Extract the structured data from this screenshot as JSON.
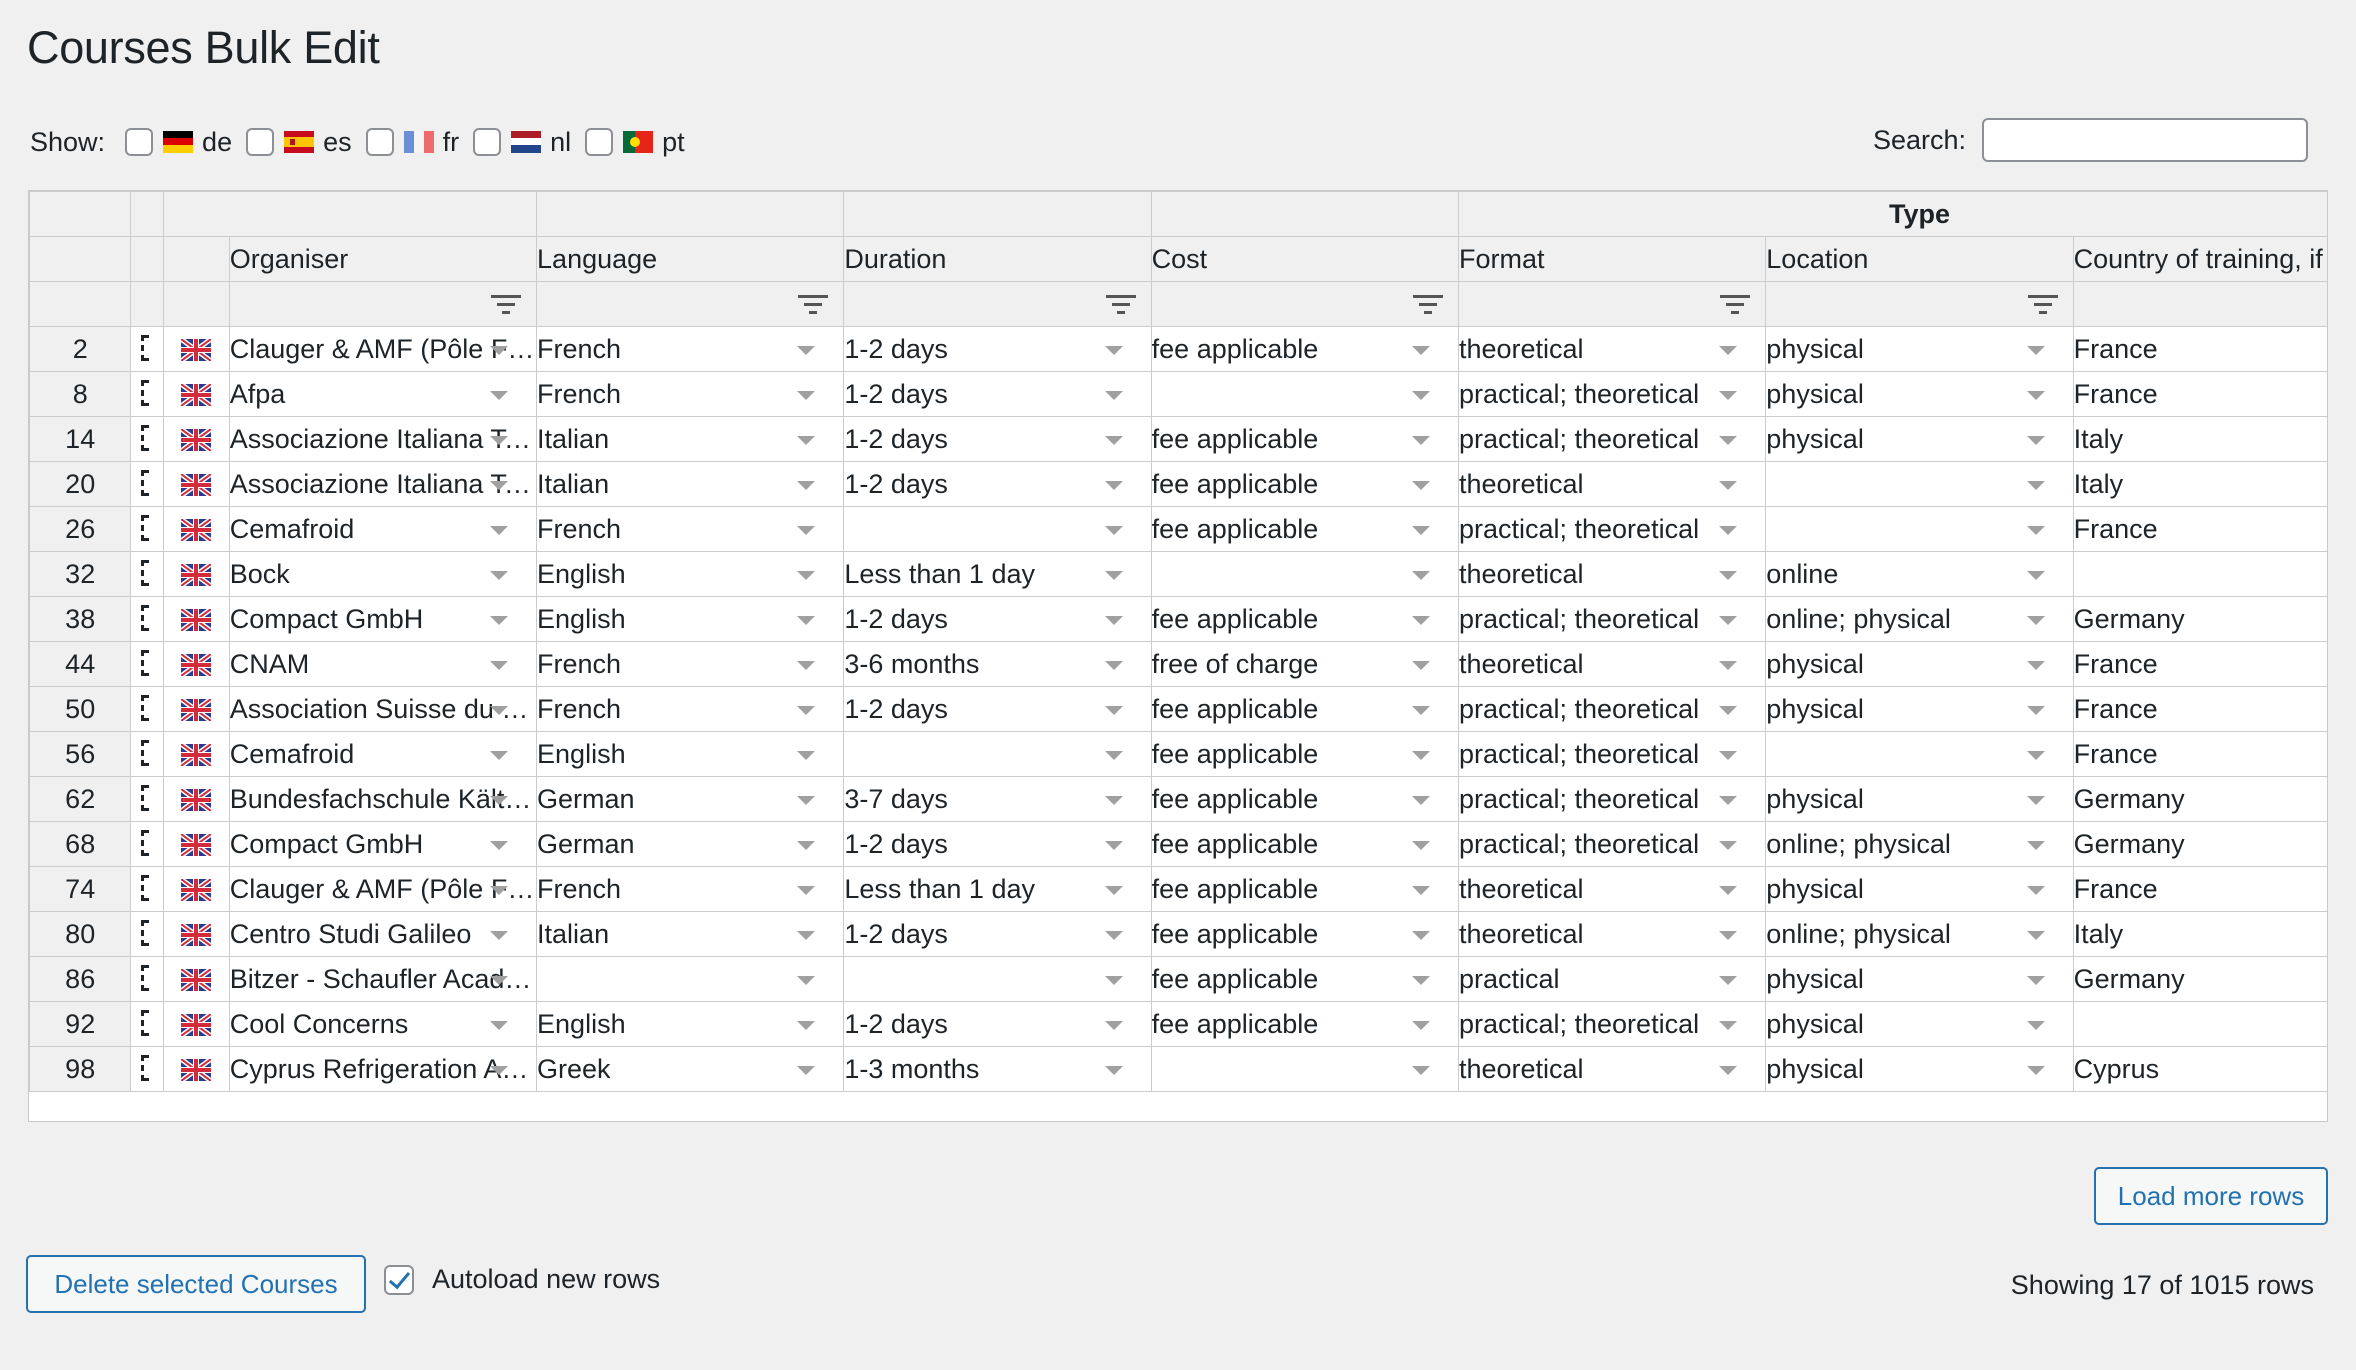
{
  "page": {
    "title": "Courses Bulk Edit"
  },
  "language_filter": {
    "label": "Show:",
    "options": [
      {
        "code": "de",
        "flag": "de-flag-icon",
        "checked": false
      },
      {
        "code": "es",
        "flag": "es-flag-icon",
        "checked": false
      },
      {
        "code": "fr",
        "flag": "fr-flag-icon",
        "checked": false
      },
      {
        "code": "nl",
        "flag": "nl-flag-icon",
        "checked": false
      },
      {
        "code": "pt",
        "flag": "pt-flag-icon",
        "checked": false
      }
    ]
  },
  "search": {
    "label": "Search:",
    "value": ""
  },
  "grid": {
    "group_header": "Type",
    "columns": [
      "Organiser",
      "Language",
      "Duration",
      "Cost",
      "Format",
      "Location",
      "Country of training, if ph"
    ],
    "rows": [
      {
        "id": "2",
        "organiser": "Clauger & AMF (Pôle Formation)",
        "language": "French",
        "duration": "1-2 days",
        "cost": "fee applicable",
        "format": "theoretical",
        "location": "physical",
        "country": "France"
      },
      {
        "id": "8",
        "organiser": "Afpa",
        "language": "French",
        "duration": "1-2 days",
        "cost": "",
        "format": "practical; theoretical",
        "location": "physical",
        "country": "France"
      },
      {
        "id": "14",
        "organiser": "Associazione Italiana Tecnici del Freddo",
        "language": "Italian",
        "duration": "1-2 days",
        "cost": "fee applicable",
        "format": "practical; theoretical",
        "location": "physical",
        "country": "Italy"
      },
      {
        "id": "20",
        "organiser": "Associazione Italiana Tecnici del Freddo",
        "language": "Italian",
        "duration": "1-2 days",
        "cost": "fee applicable",
        "format": "theoretical",
        "location": "",
        "country": "Italy"
      },
      {
        "id": "26",
        "organiser": "Cemafroid",
        "language": "French",
        "duration": "",
        "cost": "fee applicable",
        "format": "practical; theoretical",
        "location": "",
        "country": "France"
      },
      {
        "id": "32",
        "organiser": "Bock",
        "language": "English",
        "duration": "Less than 1 day",
        "cost": "",
        "format": "theoretical",
        "location": "online",
        "country": ""
      },
      {
        "id": "38",
        "organiser": "Compact GmbH",
        "language": "English",
        "duration": "1-2 days",
        "cost": "fee applicable",
        "format": "practical; theoretical",
        "location": "online; physical",
        "country": "Germany"
      },
      {
        "id": "44",
        "organiser": "CNAM",
        "language": "French",
        "duration": "3-6 months",
        "cost": "free of charge",
        "format": "theoretical",
        "location": "physical",
        "country": "France"
      },
      {
        "id": "50",
        "organiser": "Association Suisse du Froid",
        "language": "French",
        "duration": "1-2 days",
        "cost": "fee applicable",
        "format": "practical; theoretical",
        "location": "physical",
        "country": "France"
      },
      {
        "id": "56",
        "organiser": "Cemafroid",
        "language": "English",
        "duration": "",
        "cost": "fee applicable",
        "format": "practical; theoretical",
        "location": "",
        "country": "France"
      },
      {
        "id": "62",
        "organiser": "Bundesfachschule Kälte-Klima-Technik",
        "language": "German",
        "duration": "3-7 days",
        "cost": "fee applicable",
        "format": "practical; theoretical",
        "location": "physical",
        "country": "Germany"
      },
      {
        "id": "68",
        "organiser": "Compact GmbH",
        "language": "German",
        "duration": "1-2 days",
        "cost": "fee applicable",
        "format": "practical; theoretical",
        "location": "online; physical",
        "country": "Germany"
      },
      {
        "id": "74",
        "organiser": "Clauger & AMF (Pôle Formation)",
        "language": "French",
        "duration": "Less than 1 day",
        "cost": "fee applicable",
        "format": "theoretical",
        "location": "physical",
        "country": "France"
      },
      {
        "id": "80",
        "organiser": "Centro Studi Galileo",
        "language": "Italian",
        "duration": "1-2 days",
        "cost": "fee applicable",
        "format": "theoretical",
        "location": "online; physical",
        "country": "Italy"
      },
      {
        "id": "86",
        "organiser": "Bitzer - Schaufler Academy",
        "language": "",
        "duration": "",
        "cost": "fee applicable",
        "format": "practical",
        "location": "physical",
        "country": "Germany"
      },
      {
        "id": "92",
        "organiser": "Cool Concerns",
        "language": "English",
        "duration": "1-2 days",
        "cost": "fee applicable",
        "format": "practical; theoretical",
        "location": "physical",
        "country": ""
      },
      {
        "id": "98",
        "organiser": "Cyprus Refrigeration Association",
        "language": "Greek",
        "duration": "1-3 months",
        "cost": "",
        "format": "theoretical",
        "location": "physical",
        "country": "Cyprus"
      }
    ]
  },
  "buttons": {
    "load_more": "Load more rows",
    "delete_selected": "Delete selected Courses"
  },
  "autoload": {
    "label": "Autoload new rows",
    "checked": true
  },
  "status": {
    "row_count": "Showing 17 of 1015 rows"
  },
  "colors": {
    "accent": "#2271b1",
    "background": "#f0f0f1",
    "header_bg": "#f0f0f0"
  }
}
